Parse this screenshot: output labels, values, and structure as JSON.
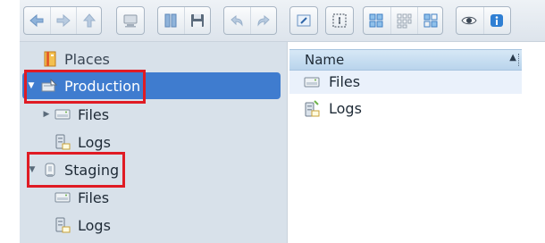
{
  "toolbar": {
    "buttons": [
      {
        "icon": "back-arrow-icon"
      },
      {
        "icon": "forward-arrow-icon"
      },
      {
        "icon": "up-arrow-icon"
      },
      {
        "icon": "connect-icon"
      },
      {
        "icon": "bookmarks-icon"
      },
      {
        "icon": "save-icon"
      },
      {
        "icon": "undo-icon"
      },
      {
        "icon": "redo-icon"
      },
      {
        "icon": "rename-icon"
      },
      {
        "icon": "select-icon"
      },
      {
        "icon": "large-icons-view-icon"
      },
      {
        "icon": "small-icons-view-icon"
      },
      {
        "icon": "details-view-icon"
      },
      {
        "icon": "preview-eye-icon"
      },
      {
        "icon": "info-icon"
      }
    ]
  },
  "tree": {
    "items": [
      {
        "label": "Places",
        "icon": "places-icon",
        "level": 0,
        "expandable": false
      },
      {
        "label": "Production",
        "icon": "server-icon",
        "level": 0,
        "expanded": true,
        "selected": true
      },
      {
        "label": "Files",
        "icon": "drive-icon",
        "level": 1,
        "expandable": true
      },
      {
        "label": "Logs",
        "icon": "logs-icon",
        "level": 1
      },
      {
        "label": "Staging",
        "icon": "staging-server-icon",
        "level": 0,
        "expanded": true
      },
      {
        "label": "Files",
        "icon": "drive-icon",
        "level": 1
      },
      {
        "label": "Logs",
        "icon": "logs-icon",
        "level": 1
      }
    ]
  },
  "list": {
    "column_header": "Name",
    "rows": [
      {
        "label": "Files",
        "icon": "drive-icon"
      },
      {
        "label": "Logs",
        "icon": "logs-icon"
      }
    ]
  },
  "colors": {
    "selection": "#3f7ccf",
    "annotation": "#e01b24",
    "tree_background": "#d8e1ea"
  }
}
